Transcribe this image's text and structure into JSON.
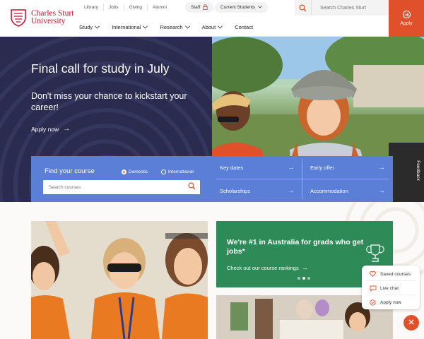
{
  "brand": {
    "line1": "Charles Sturt",
    "line2": "University",
    "accent": "#e0512b",
    "logo_red": "#c8102e"
  },
  "utility_links": [
    {
      "label": "Library"
    },
    {
      "label": "Jobs"
    },
    {
      "label": "Giving"
    },
    {
      "label": "Alumni"
    }
  ],
  "pills": {
    "staff": "Staff",
    "students": "Current Students"
  },
  "search": {
    "placeholder": "Search Charles Sturt"
  },
  "apply_button": "Apply",
  "main_nav": [
    {
      "label": "Study",
      "has_dropdown": true
    },
    {
      "label": "International",
      "has_dropdown": true
    },
    {
      "label": "Research",
      "has_dropdown": true
    },
    {
      "label": "About",
      "has_dropdown": true
    },
    {
      "label": "Contact",
      "has_dropdown": false
    }
  ],
  "hero": {
    "title": "Final call for study in July",
    "subtitle": "Don't miss your chance to kickstart your career!",
    "link": "Apply now",
    "bg_color": "#2a2b4f"
  },
  "find_course": {
    "title": "Find your course",
    "options": [
      {
        "label": "Domestic",
        "selected": true
      },
      {
        "label": "International",
        "selected": false
      }
    ],
    "placeholder": "Search courses",
    "bg_color": "#5b7fd6"
  },
  "quick_links": [
    {
      "label": "Key dates"
    },
    {
      "label": "Early offer"
    },
    {
      "label": "Scholarships"
    },
    {
      "label": "Accommodation"
    }
  ],
  "feedback_tab": "Feedback",
  "promo": {
    "title": "We're #1 in Australia for grads who get jobs*",
    "link": "Check out our course rankings",
    "bg_color": "#2e8b57",
    "slides_total": 3,
    "active_slide": 2
  },
  "quick_panel": [
    {
      "label": "Saved courses",
      "icon": "heart-icon"
    },
    {
      "label": "Live chat",
      "icon": "chat-icon"
    },
    {
      "label": "Apply now",
      "icon": "check-circle-icon"
    }
  ]
}
